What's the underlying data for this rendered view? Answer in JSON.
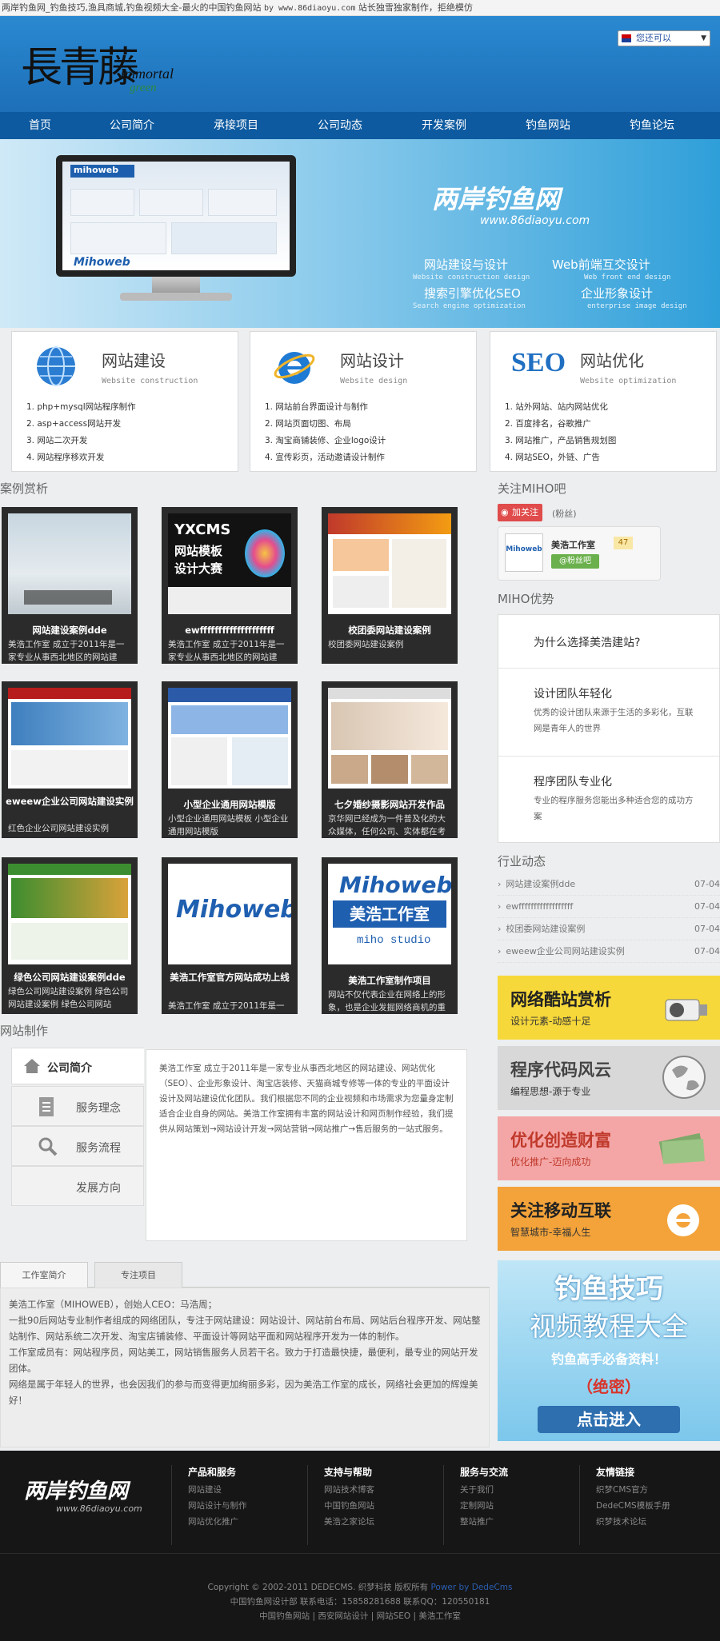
{
  "top": {
    "title": "两岸钓鱼网_钓鱼技巧,渔具商城,钓鱼视频大全-最火的中国钓鱼网站",
    "site": "by www.86diaoyu.com",
    "note": "站长独雪独家制作，拒绝模仿"
  },
  "header": {
    "logo_cn": "長青藤",
    "logo_en1": "Immortal",
    "logo_en2": "green",
    "lang": "您还可以"
  },
  "nav": [
    "首页",
    "公司简介",
    "承接项目",
    "公司动态",
    "开发案例",
    "钓鱼网站",
    "钓鱼论坛"
  ],
  "banner": {
    "logo": "两岸钓鱼网",
    "url": "www.86diaoyu.com",
    "items": [
      {
        "t": "网站建设与设计",
        "s": "Website construction design"
      },
      {
        "t": "Web前端互交设计",
        "s": "Web front end design"
      },
      {
        "t": "搜索引擎优化SEO",
        "s": "Search engine optimization"
      },
      {
        "t": "企业形象设计",
        "s": "enterprise image design"
      }
    ],
    "screen_title": "mihoweb",
    "screen_brand": "Mihoweb"
  },
  "services": [
    {
      "title": "网站建设",
      "sub": "Website construction",
      "icon": "globe-icon",
      "items": [
        "1. php+mysql网站程序制作",
        "2. asp+access网站开发",
        "3. 网站二次开发",
        "4. 网站程序移欢开发"
      ]
    },
    {
      "title": "网站设计",
      "sub": "Website design",
      "icon": "ie-icon",
      "items": [
        "1. 网站前台界面设计与制作",
        "2. 网站页面切图、布局",
        "3. 淘宝商铺装修、企业logo设计",
        "4. 宣传彩页，活动邀请设计制作"
      ]
    },
    {
      "title": "网站优化",
      "sub": "Website optimization",
      "icon": "seo-icon",
      "items": [
        "1. 站外网站、站内网站优化",
        "2. 百度排名，谷歌推广",
        "3. 网站推广，产品销售规划图",
        "4. 网站SEO，外链、广告"
      ]
    }
  ],
  "cases_title": "案例赏析",
  "cases": [
    {
      "title": "网站建设案例dde",
      "desc": "美浩工作室  成立于2011年是一家专业从事西北地区的网站建"
    },
    {
      "title": "ewffffffffffffffffffff",
      "desc": "美浩工作室  成立于2011年是一家专业从事西北地区的网站建"
    },
    {
      "title": "校团委网站建设案例",
      "desc": "校团委网站建设案例"
    },
    {
      "title": "eweew企业公司网站建设实例",
      "desc": "红色企业公司网站建设实例"
    },
    {
      "title": "小型企业通用网站模版",
      "desc": "小型企业通用网站模板  小型企业通用网站模版"
    },
    {
      "title": "七夕婚纱摄影网站开发作品",
      "desc": "京华网已经成为一件普及化的大众媒体，任何公司、实体都在考"
    },
    {
      "title": "绿色公司网站建设案例dde",
      "desc": "绿色公司网站建设案例  绿色公司网站建设案例  绿色公司网站"
    },
    {
      "title": "美浩工作室官方网站成功上线",
      "desc": "美浩工作室  成立于2011年是一"
    },
    {
      "title": "美浩工作室制作项目",
      "desc": "网站不仅代表企业在网络上的形象，也是企业发掘网络商机的重"
    }
  ],
  "case_imgs": {
    "yxcms1": "YXCMS",
    "yxcms2": "网站模板",
    "yxcms3": "设计大赛",
    "miho_en": "Mihoweb",
    "miho_cn": "美浩工作室",
    "miho_sub": "miho studio"
  },
  "sidebar": {
    "tieba_title": "关注MIHO吧",
    "follow": "加关注",
    "fans": "(粉丝)",
    "studio": "美浩工作室",
    "studio_lvl": "47",
    "studio_btn": "@粉丝吧",
    "adv_title": "MIHO优势",
    "adv_q": "为什么选择美浩建站?",
    "adv": [
      {
        "t": "设计团队年轻化",
        "d": "优秀的设计团队来源于生活的多彩化，互联网是青年人的世界"
      },
      {
        "t": "程序团队专业化",
        "d": "专业的程序服务您能出多种适合您的成功方案"
      }
    ],
    "news_title": "行业动态",
    "news": [
      {
        "t": "网站建设案例dde",
        "d": "07-04"
      },
      {
        "t": "ewffffffffffffffffff",
        "d": "07-04"
      },
      {
        "t": "校团委网站建设案例",
        "d": "07-04"
      },
      {
        "t": "eweew企业公司网站建设实例",
        "d": "07-04"
      }
    ],
    "promos": [
      {
        "t": "网络酷站赏析",
        "s": "设计元素-动感十足",
        "bg": "#f7d83a",
        "fg": "#222"
      },
      {
        "t": "程序代码风云",
        "s": "编程思想-源于专业",
        "bg": "#d8d8d8",
        "fg": "#333"
      },
      {
        "t": "优化创造财富",
        "s": "优化推广-迈向成功",
        "bg": "#f4a6a6",
        "fg": "#c0392b"
      },
      {
        "t": "关注移动互联",
        "s": "智慧城市-幸福人生",
        "bg": "#f3a33a",
        "fg": "#222"
      }
    ],
    "big_ad": {
      "t1": "钓鱼技巧",
      "t2": "视频教程大全",
      "t3": "钓鱼高手必备资料！",
      "t4": "（绝密）",
      "btn": "点击进入"
    }
  },
  "make": {
    "title": "网站制作",
    "tabs": [
      "公司简介",
      "服务理念",
      "服务流程",
      "发展方向"
    ],
    "text": "美浩工作室  成立于2011年是一家专业从事西北地区的网站建设、网站优化（SEO）、企业形象设计、淘宝店装修、天猫商城专修等一体的专业的平面设计设计及网站建设优化团队。我们根据您不同的企业视频和市场需求为您量身定制适合企业自身的网站。美浩工作室拥有丰富的网站设计和网页制作经验，我们提供从网站策划→网站设计开发→网站营销→网站推广→售后服务的一站式服务。"
  },
  "studio": {
    "tabs": [
      "工作室简介",
      "专注项目"
    ],
    "lines": [
      "美浩工作室（MIHOWEB），创始人CEO：马浩周；",
      "一批90后网站专业制作者组成的网络团队，专注于网站建设：网站设计、网站前台布局、网站后台程序开发、网站整站制作、网站系统二次开发、淘宝店铺装修、平面设计等网站平面和网站程序开发为一体的制作。",
      "工作室成员有：网站程序员，网站美工，网站销售服务人员若干名。致力于打造最快捷，最便利，最专业的网站开发团体。",
      "网络是属于年轻人的世界，也会因我们的参与而变得更加绚丽多彩，因为美浩工作室的成长，网络社会更加的辉煌美好！"
    ]
  },
  "footer": {
    "logo": "两岸钓鱼网",
    "url": "www.86diaoyu.com",
    "cols": [
      {
        "h": "产品和服务",
        "items": [
          "网站建设",
          "网站设计与制作",
          "网站优化推广"
        ]
      },
      {
        "h": "支持与帮助",
        "items": [
          "网站技术博客",
          "中国钓鱼网站",
          "美浩之家论坛"
        ]
      },
      {
        "h": "服务与交流",
        "items": [
          "关于我们",
          "定制网站",
          "整站推广"
        ]
      },
      {
        "h": "友情链接",
        "items": [
          "织梦CMS官方",
          "DedeCMS模板手册",
          "织梦技术论坛"
        ]
      }
    ],
    "copy": "Copyright © 2002-2011 DEDECMS. 织梦科技 版权所有",
    "powered": "Power by DedeCms",
    "line2": "中国钓鱼网设计部 联系电话：15858281688 联系QQ：120550181",
    "line3": "中国钓鱼网站 | 西安网站设计 | 网站SEO | 美浩工作室"
  },
  "colors": {
    "nav": "#0d5aa0",
    "header": "#2a89d1",
    "accent": "#2f9fd9"
  }
}
